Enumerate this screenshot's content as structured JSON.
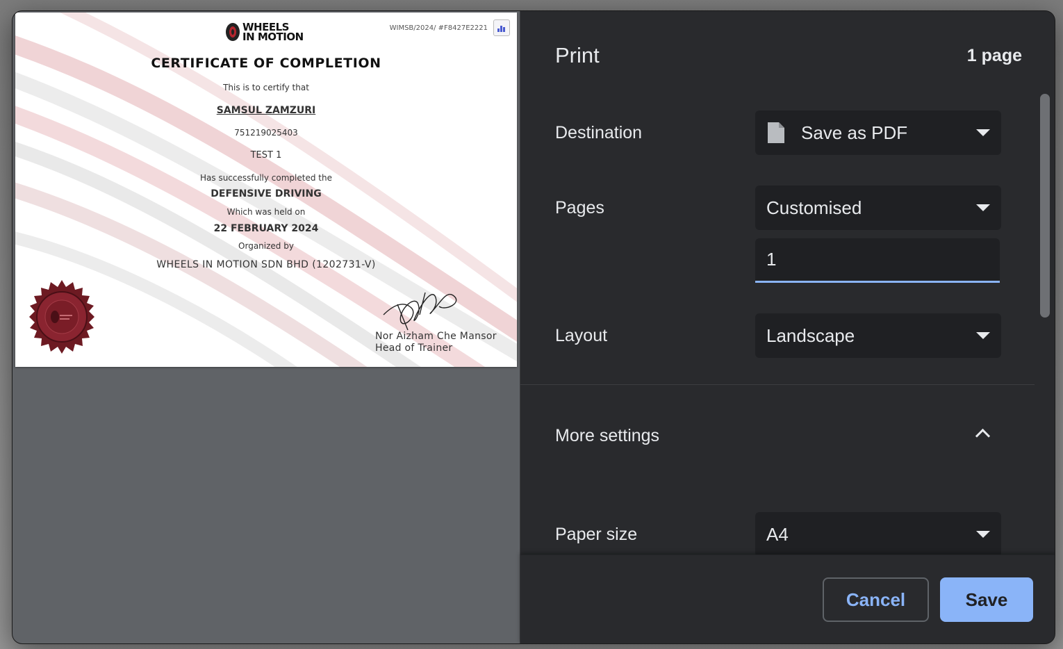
{
  "print": {
    "title": "Print",
    "page_count": "1 page",
    "destination": {
      "label": "Destination",
      "value": "Save as PDF"
    },
    "pages": {
      "label": "Pages",
      "value": "Customised",
      "custom_range": "1"
    },
    "layout": {
      "label": "Layout",
      "value": "Landscape"
    },
    "more_settings": {
      "label": "More settings"
    },
    "paper_size": {
      "label": "Paper size",
      "value": "A4"
    },
    "buttons": {
      "cancel": "Cancel",
      "save": "Save"
    }
  },
  "certificate": {
    "logo_line1": "WHEELS",
    "logo_line2": "IN MOTION",
    "ref": "WIMSB/2024/ #F8427E2221",
    "heading": "CERTIFICATE OF COMPLETION",
    "certify": "This is to certify that",
    "name": "SAMSUL ZAMZURI",
    "id_no": "751219025403",
    "test": "TEST 1",
    "completed": "Has successfully completed the",
    "course": "DEFENSIVE DRIVING",
    "held_on": "Which was held on",
    "date": "22 FEBRUARY 2024",
    "organized_by": "Organized by",
    "organizer": "WHEELS IN MOTION SDN BHD (1202731-V)",
    "signer_name": "Nor Aizham Che Mansor",
    "signer_title": "Head of Trainer"
  },
  "colors": {
    "accent": "#8ab4f8",
    "panel": "#292a2d",
    "field": "#1f2023",
    "text": "#e8eaed",
    "preview_bg": "#606367"
  },
  "icons": {
    "destination": "document-icon",
    "expand": "chevron-up-icon",
    "dropdown": "dropdown-caret-icon"
  }
}
